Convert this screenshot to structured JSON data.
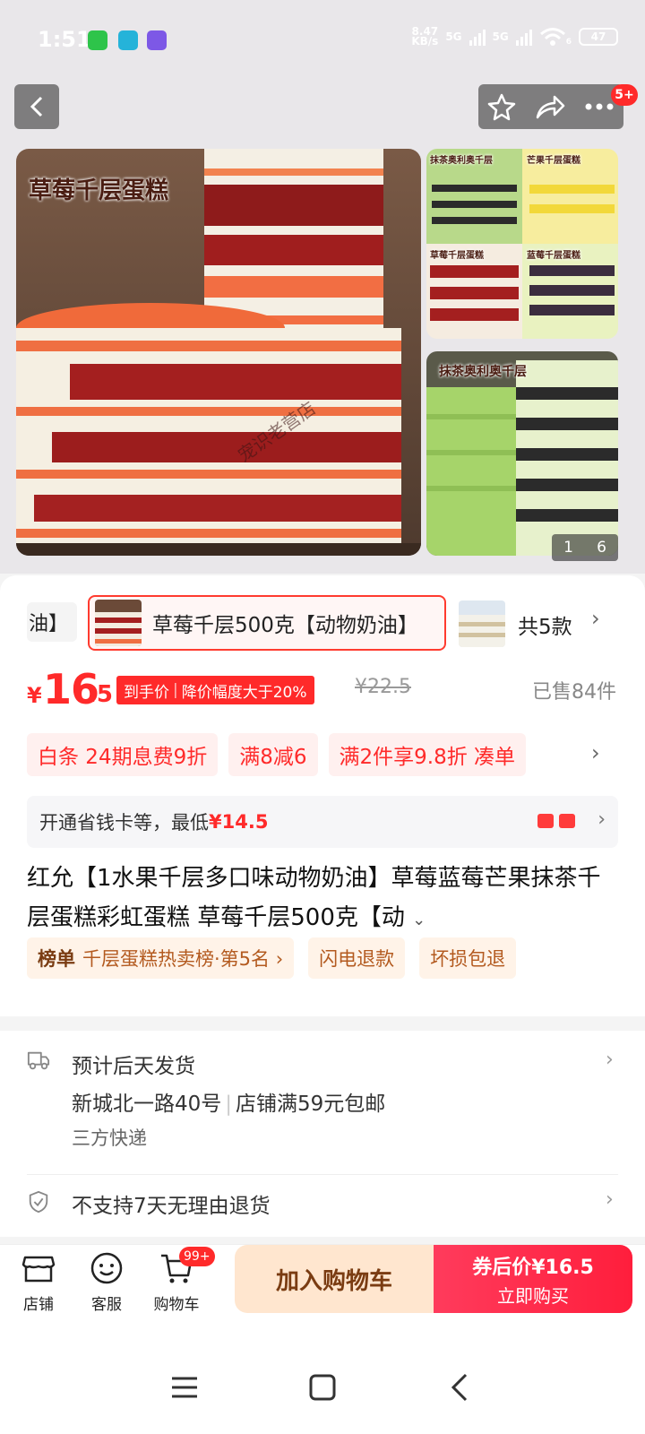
{
  "status_bar": {
    "time": "1:51",
    "net_speed_value": "8.47",
    "net_speed_unit": "KB/s",
    "signal1": "5G",
    "signal2": "5G",
    "wifi_suffix": "6",
    "battery": "47"
  },
  "top_nav": {
    "more_badge": "5+"
  },
  "gallery": {
    "main_label": "草莓千层蛋糕",
    "watermark": "宠识老营店",
    "thumb1_labels": [
      "抹茶奥利奥千层",
      "芒果千层蛋糕",
      "草莓千层蛋糕",
      "蓝莓千层蛋糕"
    ],
    "thumb2_label": "抹茶奥利奥千层",
    "counter_current": "1",
    "counter_total": "6"
  },
  "variants": {
    "prev_partial": "油】",
    "selected": "草莓千层500克【动物奶油】",
    "total": "共5款"
  },
  "price": {
    "currency": "¥",
    "integer": "16",
    "decimal": ".5",
    "tag_label": "到手价",
    "tag_detail": "降价幅度大于20%",
    "original": "¥22.5",
    "sold": "已售84件"
  },
  "promos": [
    "白条  24期息费9折",
    "满8减6",
    "满2件享9.8折  凑单"
  ],
  "vip": {
    "text": "开通省钱卡等，最低",
    "amount": "¥14.5"
  },
  "product_title": "红允【1水果千层多口味动物奶油】草莓蓝莓芒果抹茶千层蛋糕彩虹蛋糕 草莓千层500克【动",
  "chips": {
    "rank_title": "榜单",
    "rank_text": "千层蛋糕热卖榜·第5名 ›",
    "refund": "闪电退款",
    "damage": "坏损包退"
  },
  "service": {
    "delivery": "预计后天发货",
    "address": "新城北一路40号",
    "shipping": "店铺满59元包邮",
    "courier": "三方快递",
    "return_policy": "不支持7天无理由退货"
  },
  "action_bar": {
    "shop": "店铺",
    "service": "客服",
    "cart": "购物车",
    "cart_badge": "99+",
    "add_to_cart": "加入购物车",
    "buy_line1": "券后价¥16.5",
    "buy_line2": "立即购买"
  },
  "colors": {
    "accent": "#ff2a2a",
    "cart_button_bg": "#ffe6cf",
    "chip_bg": "#fff3e8"
  }
}
